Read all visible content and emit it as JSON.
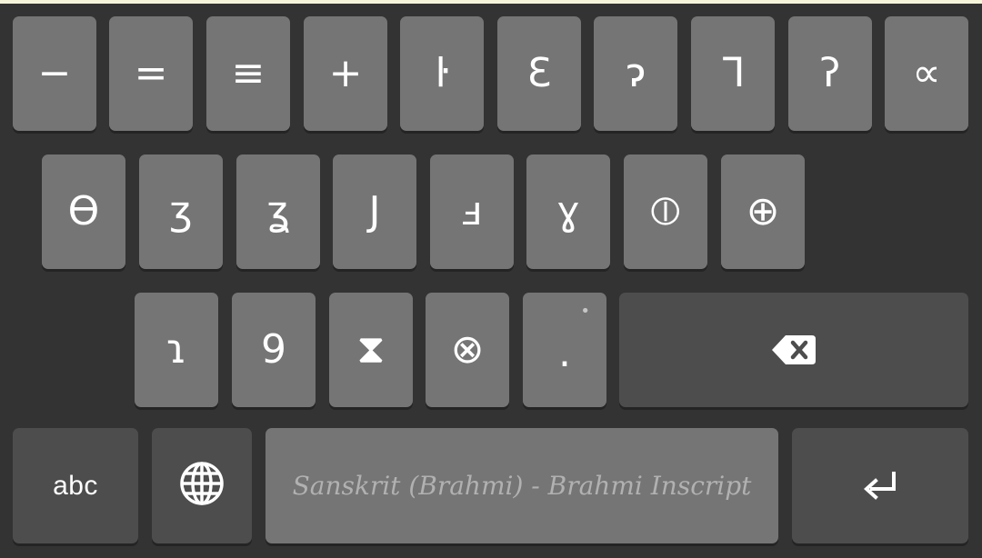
{
  "keyboard": {
    "rows": [
      [
        {
          "label": "−",
          "name": "key-minus"
        },
        {
          "label": "=",
          "name": "key-equals"
        },
        {
          "label": "≡",
          "name": "key-triple-bar"
        },
        {
          "label": "+",
          "name": "key-plus"
        },
        {
          "label": "ŀ",
          "name": "key-brahmi-1"
        },
        {
          "label": "Ɛ",
          "name": "key-brahmi-2"
        },
        {
          "label": "ɂ",
          "name": "key-brahmi-3"
        },
        {
          "label": "ᒣ",
          "name": "key-brahmi-4"
        },
        {
          "label": "ʔ",
          "name": "key-brahmi-5"
        },
        {
          "label": "∝",
          "name": "key-brahmi-6"
        }
      ],
      [
        {
          "label": "ϴ",
          "name": "key-brahmi-7"
        },
        {
          "label": "ʒ",
          "name": "key-brahmi-8"
        },
        {
          "label": "ʓ",
          "name": "key-brahmi-9"
        },
        {
          "label": "J",
          "name": "key-brahmi-10"
        },
        {
          "label": "ⅎ",
          "name": "key-brahmi-11"
        },
        {
          "label": "ɣ",
          "name": "key-brahmi-12"
        },
        {
          "label": "⦶",
          "name": "key-brahmi-13"
        },
        {
          "label": "⊕",
          "name": "key-brahmi-14"
        }
      ],
      [
        {
          "label": "ɿ",
          "name": "key-brahmi-15"
        },
        {
          "label": "9",
          "name": "key-brahmi-16"
        },
        {
          "label": "⧗",
          "name": "key-brahmi-17"
        },
        {
          "label": "⊗",
          "name": "key-brahmi-18"
        },
        {
          "label": ".",
          "name": "key-period",
          "hint": "•"
        }
      ]
    ],
    "bottom": {
      "abc_label": "abc",
      "space_label": "Sanskrit (Brahmi) - Brahmi Inscript"
    },
    "icons": {
      "backspace": "backspace-icon",
      "globe": "globe-icon",
      "enter": "enter-icon"
    },
    "colors": {
      "background": "#333333",
      "key": "#757575",
      "function_key": "#4d4d4d",
      "key_text": "#ffffff",
      "space_text": "#b1b1b1",
      "top_line": "#f6f5d9"
    }
  }
}
